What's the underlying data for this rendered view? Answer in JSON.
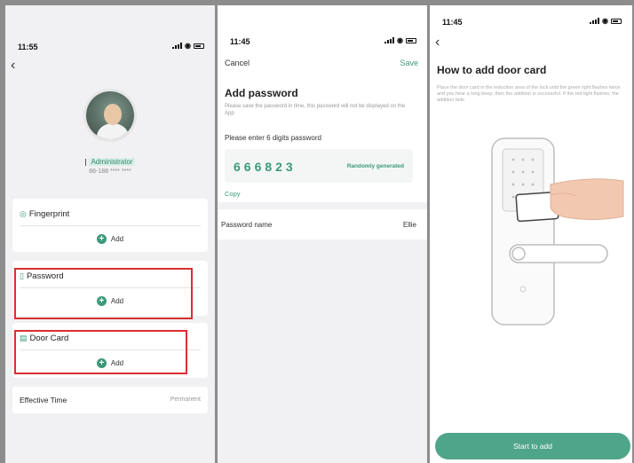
{
  "screen1": {
    "time": "11:55",
    "role": "Administrator",
    "phone": "86-188 **** ****",
    "fingerprint": {
      "label": "Fingerprint",
      "add": "Add"
    },
    "password": {
      "label": "Password",
      "add": "Add"
    },
    "door_card": {
      "label": "Door Card",
      "add": "Add"
    },
    "effective_time": {
      "label": "Effective Time",
      "value": "Permanent"
    }
  },
  "screen2": {
    "time": "11:45",
    "cancel": "Cancel",
    "save": "Save",
    "title": "Add password",
    "description": "Please save the password in time, this password will not be displayed on the App",
    "prompt": "Please enter 6 digits password",
    "password_value": "666823",
    "random": "Randomly generated",
    "copy": "Copy",
    "name_label": "Password name",
    "name_value": "Ellie"
  },
  "screen3": {
    "time": "11:45",
    "title": "How to add door card",
    "description": "Place the door card in the induction area of the lock until the green light flashes twice and you hear a long beep, then the addition is successful. If the red light flashes, the addition fails.",
    "start_button": "Start to add"
  },
  "colors": {
    "accent": "#3a9a78",
    "highlight_box": "#d93030",
    "start_button": "#4fa58a"
  }
}
